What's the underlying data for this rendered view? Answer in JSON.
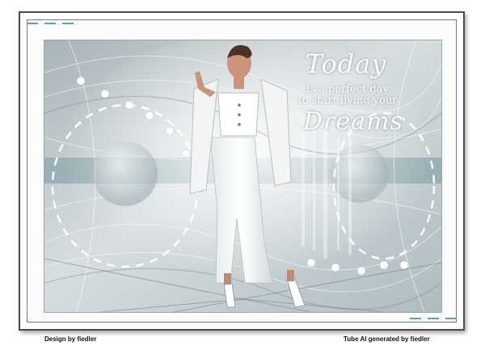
{
  "quote": {
    "word_top": "Today",
    "line1": "is a perfect day",
    "line2": "to start living your",
    "word_bottom": "Dreams"
  },
  "credits": {
    "left": "Design by fiedler",
    "right": "Tube AI generated by fiedler"
  },
  "colors": {
    "accent_dash": "#5a9fc1",
    "frame": "#4b4b4b",
    "artwork_base": "#c9d1d4",
    "teal_band": "#8ea7ae"
  }
}
